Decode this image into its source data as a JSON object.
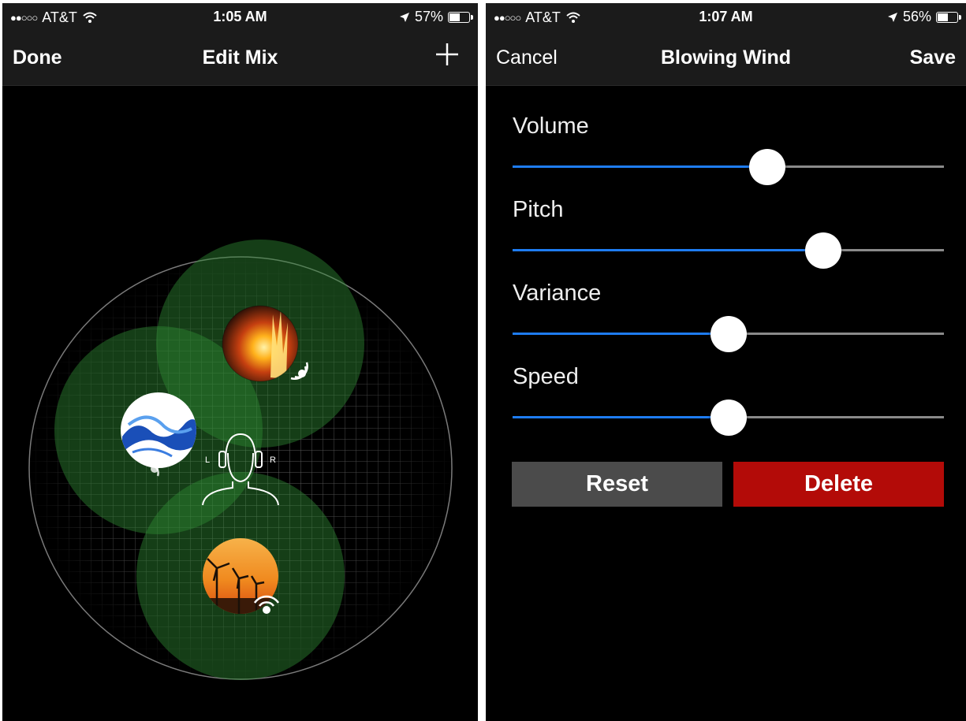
{
  "left": {
    "status": {
      "carrier": "AT&T",
      "time": "1:05 AM",
      "battery": "57%",
      "battery_level": 0.57
    },
    "nav": {
      "left": "Done",
      "title": "Edit Mix",
      "right_icon": "plus-icon"
    },
    "listener": {
      "left_label": "L",
      "right_label": "R",
      "icon": "headphones-person-icon"
    },
    "sounds": [
      {
        "name": "fire",
        "icon": "fire-image",
        "indicator_icon": "sound-waves-icon"
      },
      {
        "name": "water",
        "icon": "water-splash-image",
        "indicator_icon": "sound-waves-icon"
      },
      {
        "name": "wind",
        "icon": "wind-turbines-image",
        "indicator_icon": "wifi-waves-icon"
      }
    ]
  },
  "right": {
    "status": {
      "carrier": "AT&T",
      "time": "1:07 AM",
      "battery": "56%",
      "battery_level": 0.56
    },
    "nav": {
      "left": "Cancel",
      "title": "Blowing Wind",
      "right": "Save"
    },
    "sliders": [
      {
        "label": "Volume",
        "value": 0.59
      },
      {
        "label": "Pitch",
        "value": 0.72
      },
      {
        "label": "Variance",
        "value": 0.5
      },
      {
        "label": "Speed",
        "value": 0.5
      }
    ],
    "buttons": {
      "reset": "Reset",
      "delete": "Delete"
    }
  },
  "colors": {
    "accent": "#1e7cf2",
    "delete": "#b30b08",
    "reset": "#4b4b4b",
    "zone": "#2f8a33"
  }
}
